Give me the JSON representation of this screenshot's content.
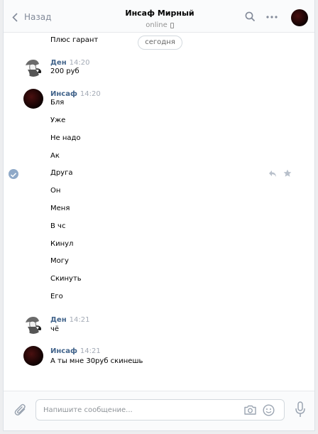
{
  "header": {
    "back_label": "Назад",
    "chat_title": "Инсаф Мирный",
    "status": "online"
  },
  "chat": {
    "date_divider": "сегодня",
    "earlier_text": "Плюс гарант",
    "groups": [
      {
        "sender": "Ден",
        "time": "14:20",
        "messages": [
          "200 руб"
        ]
      },
      {
        "sender": "Инсаф",
        "time": "14:20",
        "messages": [
          "Бля",
          "Уже",
          "Не надо",
          "Ак",
          "Друга",
          "Он",
          "Меня",
          "В чс",
          "Кинул",
          "Могу",
          "Скинуть",
          "Его"
        ]
      },
      {
        "sender": "Ден",
        "time": "14:21",
        "messages": [
          "чё"
        ]
      },
      {
        "sender": "Инсаф",
        "time": "14:21",
        "messages": [
          "А ты мне 30руб скинешь"
        ]
      }
    ]
  },
  "composer": {
    "placeholder": "Напишите сообщение..."
  },
  "colors": {
    "link_name": "#42648b",
    "time": "#a4abb6",
    "icon": "#828a99",
    "check": "#8fa9c8"
  },
  "icons": [
    "back-chevron-icon",
    "phone-icon",
    "search-icon",
    "more-icon",
    "check-icon",
    "reply-icon",
    "star-icon",
    "attach-icon",
    "camera-icon",
    "emoji-icon",
    "microphone-icon"
  ]
}
